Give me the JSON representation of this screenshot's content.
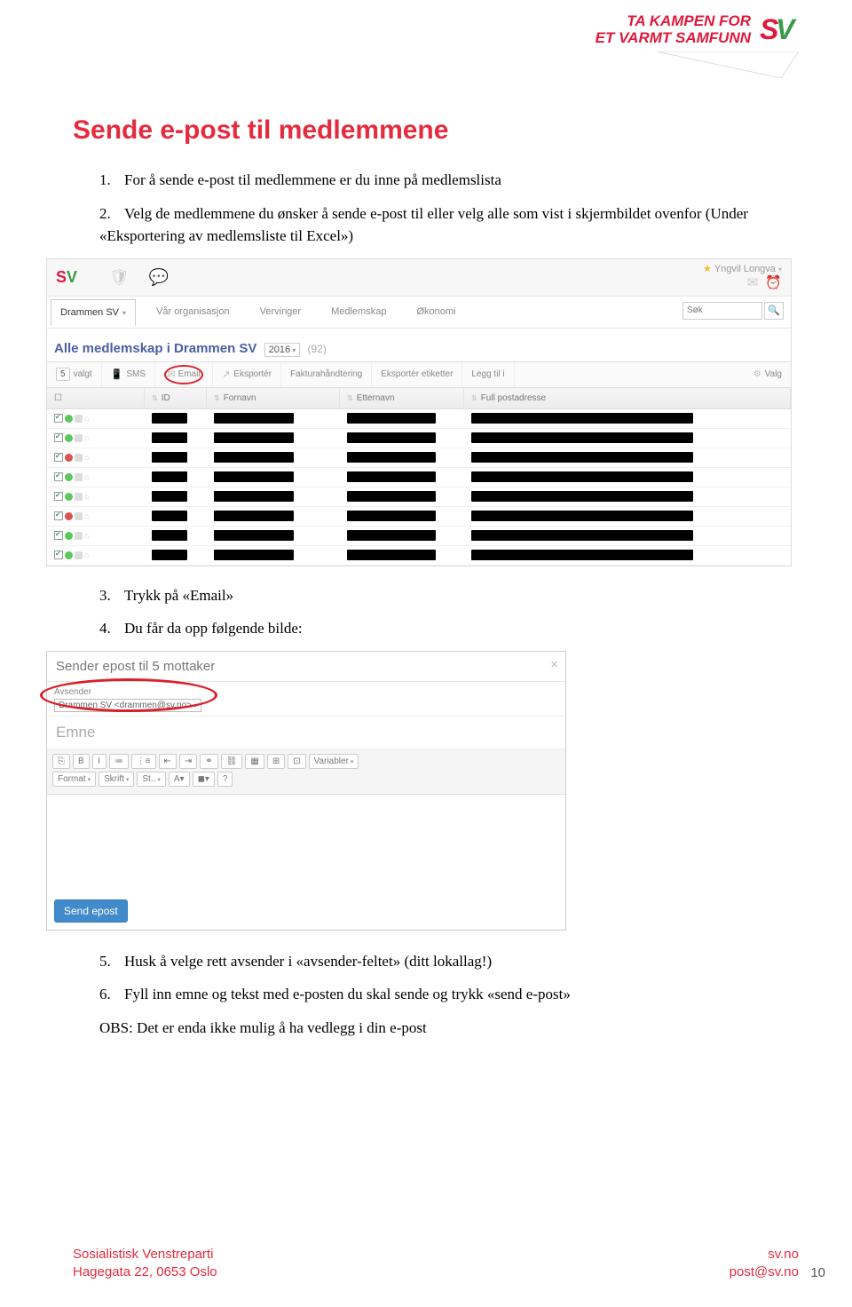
{
  "header": {
    "slogan_line1": "TA KAMPEN FOR",
    "slogan_line2": "ET VARMT SAMFUNN",
    "logo_s": "S",
    "logo_v": "V"
  },
  "title": "Sende e-post til medlemmene",
  "steps": {
    "s1_num": "1.",
    "s1": "For å sende e-post til medlemmene er du inne på medlemslista",
    "s2_num": "2.",
    "s2": "Velg de medlemmene du ønsker å sende e-post til eller velg alle som vist i skjermbildet ovenfor (Under «Eksportering av medlemsliste til Excel»)",
    "s3_num": "3.",
    "s3": "Trykk på «Email»",
    "s4_num": "4.",
    "s4": "Du får da opp følgende bilde:",
    "s5_num": "5.",
    "s5": "Husk å velge rett avsender i «avsender-feltet» (ditt lokallag!)",
    "s6_num": "6.",
    "s6": "Fyll inn emne og tekst med e-posten du skal sende og trykk «send e-post»",
    "obs": "OBS: Det er enda ikke mulig å ha vedlegg i din e-post"
  },
  "shot1": {
    "user": "Yngvil Longva",
    "nav_active": "Drammen SV",
    "nav": [
      "Vår organisasjon",
      "Vervinger",
      "Medlemskap",
      "Økonomi"
    ],
    "search_placeholder": "Søk",
    "title_pre": "Alle medlemskap i Drammen SV",
    "year": "2016",
    "count": "(92)",
    "toolbar": {
      "selcount": "5",
      "valgt": "valgt",
      "sms": "SMS",
      "email": "Email",
      "eksporter": "Eksportér",
      "fakt": "Fakturahåndtering",
      "eksportet": "Eksportér etiketter",
      "leggtil": "Legg til i",
      "valg": "Valg"
    },
    "thead": {
      "id": "ID",
      "fornavn": "Fornavn",
      "etternavn": "Etternavn",
      "addr": "Full postadresse"
    },
    "row_dots": [
      "green",
      "green",
      "red",
      "green",
      "green",
      "red",
      "green",
      "green"
    ]
  },
  "shot2": {
    "head": "Sender epost til 5 mottaker",
    "avs_label": "Avsender",
    "avs_value": "Drammen SV <drammen@sv.no>",
    "emne": "Emne",
    "rt_row1": [
      "⎘",
      "B",
      "I",
      "≔",
      "⋮≡",
      "⇤",
      "⇥",
      "⚭",
      "⛓",
      "▦",
      "⊞",
      "⊡"
    ],
    "rt_var": "Variabler",
    "rt_row2_format": "Format",
    "rt_row2_skrift": "Skrift",
    "rt_row2_st": "St..",
    "rt_row2_a1": "A▾",
    "rt_row2_a2": "◼▾",
    "rt_row2_q": "?",
    "send": "Send epost"
  },
  "footer": {
    "org": "Sosialistisk Venstreparti",
    "addr": "Hagegata 22, 0653 Oslo",
    "site": "sv.no",
    "email": "post@sv.no"
  },
  "page": "10"
}
